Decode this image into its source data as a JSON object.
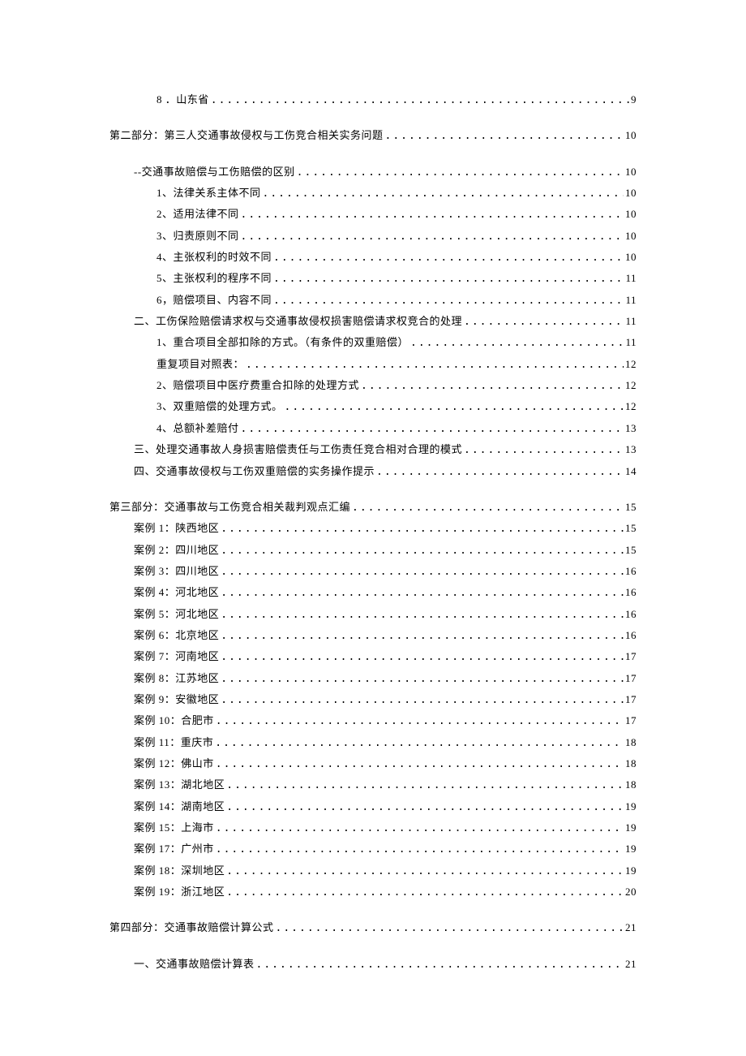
{
  "toc": [
    {
      "indent": 2,
      "label": "8 ．山东省",
      "page": "9",
      "gap": false
    },
    {
      "indent": 0,
      "label": "第二部分：第三人交通事故侵权与工伤竞合相关实务问题",
      "page": "10",
      "gap": true
    },
    {
      "indent": 1,
      "label": "--交通事故赔偿与工伤赔偿的区别",
      "page": "10",
      "gap": true
    },
    {
      "indent": 2,
      "label": "1、法律关系主体不同",
      "page": "10",
      "gap": false
    },
    {
      "indent": 2,
      "label": "2、适用法律不同",
      "page": "10",
      "gap": false
    },
    {
      "indent": 2,
      "label": "3、归责原则不同",
      "page": "10",
      "gap": false
    },
    {
      "indent": 2,
      "label": "4、主张权利的时效不同",
      "page": "10",
      "gap": false
    },
    {
      "indent": 2,
      "label": "5、主张权利的程序不同",
      "page": "11",
      "gap": false
    },
    {
      "indent": 2,
      "label": "6，赔偿项目、内容不同",
      "page": "11",
      "gap": false
    },
    {
      "indent": 1,
      "label": "二、工伤保险赔偿请求权与交通事故侵权损害赔偿请求权竞合的处理",
      "page": "11",
      "gap": false
    },
    {
      "indent": 2,
      "label": "1、重合项目全部扣除的方式。（有条件的双重赔偿）",
      "page": "11",
      "gap": false
    },
    {
      "indent": 2,
      "label": "重复项目对照表：",
      "page": "12",
      "gap": false
    },
    {
      "indent": 2,
      "label": "2、赔偿项目中医疗费重合扣除的处理方式",
      "page": "12",
      "gap": false
    },
    {
      "indent": 2,
      "label": "3、双重赔偿的处理方式。",
      "page": "12",
      "gap": false
    },
    {
      "indent": 2,
      "label": "4、总额补差赔付",
      "page": "13",
      "gap": false
    },
    {
      "indent": 1,
      "label": "三、处理交通事故人身损害赔偿责任与工伤责任竞合相对合理的模式",
      "page": "13",
      "gap": false
    },
    {
      "indent": 1,
      "label": "四、交通事故侵权与工伤双重赔偿的实务操作提示",
      "page": "14",
      "gap": false
    },
    {
      "indent": 0,
      "label": "第三部分：交通事故与工伤竞合相关裁判观点汇编",
      "page": "15",
      "gap": true
    },
    {
      "indent": 1,
      "label": "案例 1：陕西地区",
      "page": "15",
      "gap": false
    },
    {
      "indent": 1,
      "label": "案例 2：四川地区",
      "page": "15",
      "gap": false
    },
    {
      "indent": 1,
      "label": "案例 3：四川地区",
      "page": "16",
      "gap": false
    },
    {
      "indent": 1,
      "label": "案例 4：河北地区",
      "page": "16",
      "gap": false
    },
    {
      "indent": 1,
      "label": "案例 5：河北地区",
      "page": "16",
      "gap": false
    },
    {
      "indent": 1,
      "label": "案例 6：北京地区",
      "page": "16",
      "gap": false
    },
    {
      "indent": 1,
      "label": "案例 7：河南地区",
      "page": "17",
      "gap": false
    },
    {
      "indent": 1,
      "label": "案例 8：江苏地区",
      "page": "17",
      "gap": false
    },
    {
      "indent": 1,
      "label": "案例 9：安徽地区",
      "page": "17",
      "gap": false
    },
    {
      "indent": 1,
      "label": "案例 10：合肥市",
      "page": "17",
      "gap": false
    },
    {
      "indent": 1,
      "label": "案例 11：重庆市",
      "page": "18",
      "gap": false
    },
    {
      "indent": 1,
      "label": "案例 12：佛山市",
      "page": "18",
      "gap": false
    },
    {
      "indent": 1,
      "label": "案例 13：湖北地区",
      "page": "18",
      "gap": false
    },
    {
      "indent": 1,
      "label": "案例 14：湖南地区",
      "page": "19",
      "gap": false
    },
    {
      "indent": 1,
      "label": "案例 15：上海市",
      "page": "19",
      "gap": false
    },
    {
      "indent": 1,
      "label": "案例 17：广州市",
      "page": "19",
      "gap": false
    },
    {
      "indent": 1,
      "label": "案例 18：深圳地区",
      "page": "19",
      "gap": false
    },
    {
      "indent": 1,
      "label": "案例 19：浙江地区",
      "page": "20",
      "gap": false
    },
    {
      "indent": 0,
      "label": "第四部分：交通事故赔偿计算公式",
      "page": "21",
      "gap": true
    },
    {
      "indent": 1,
      "label": "一、交通事故赔偿计算表",
      "page": "21",
      "gap": true
    }
  ]
}
